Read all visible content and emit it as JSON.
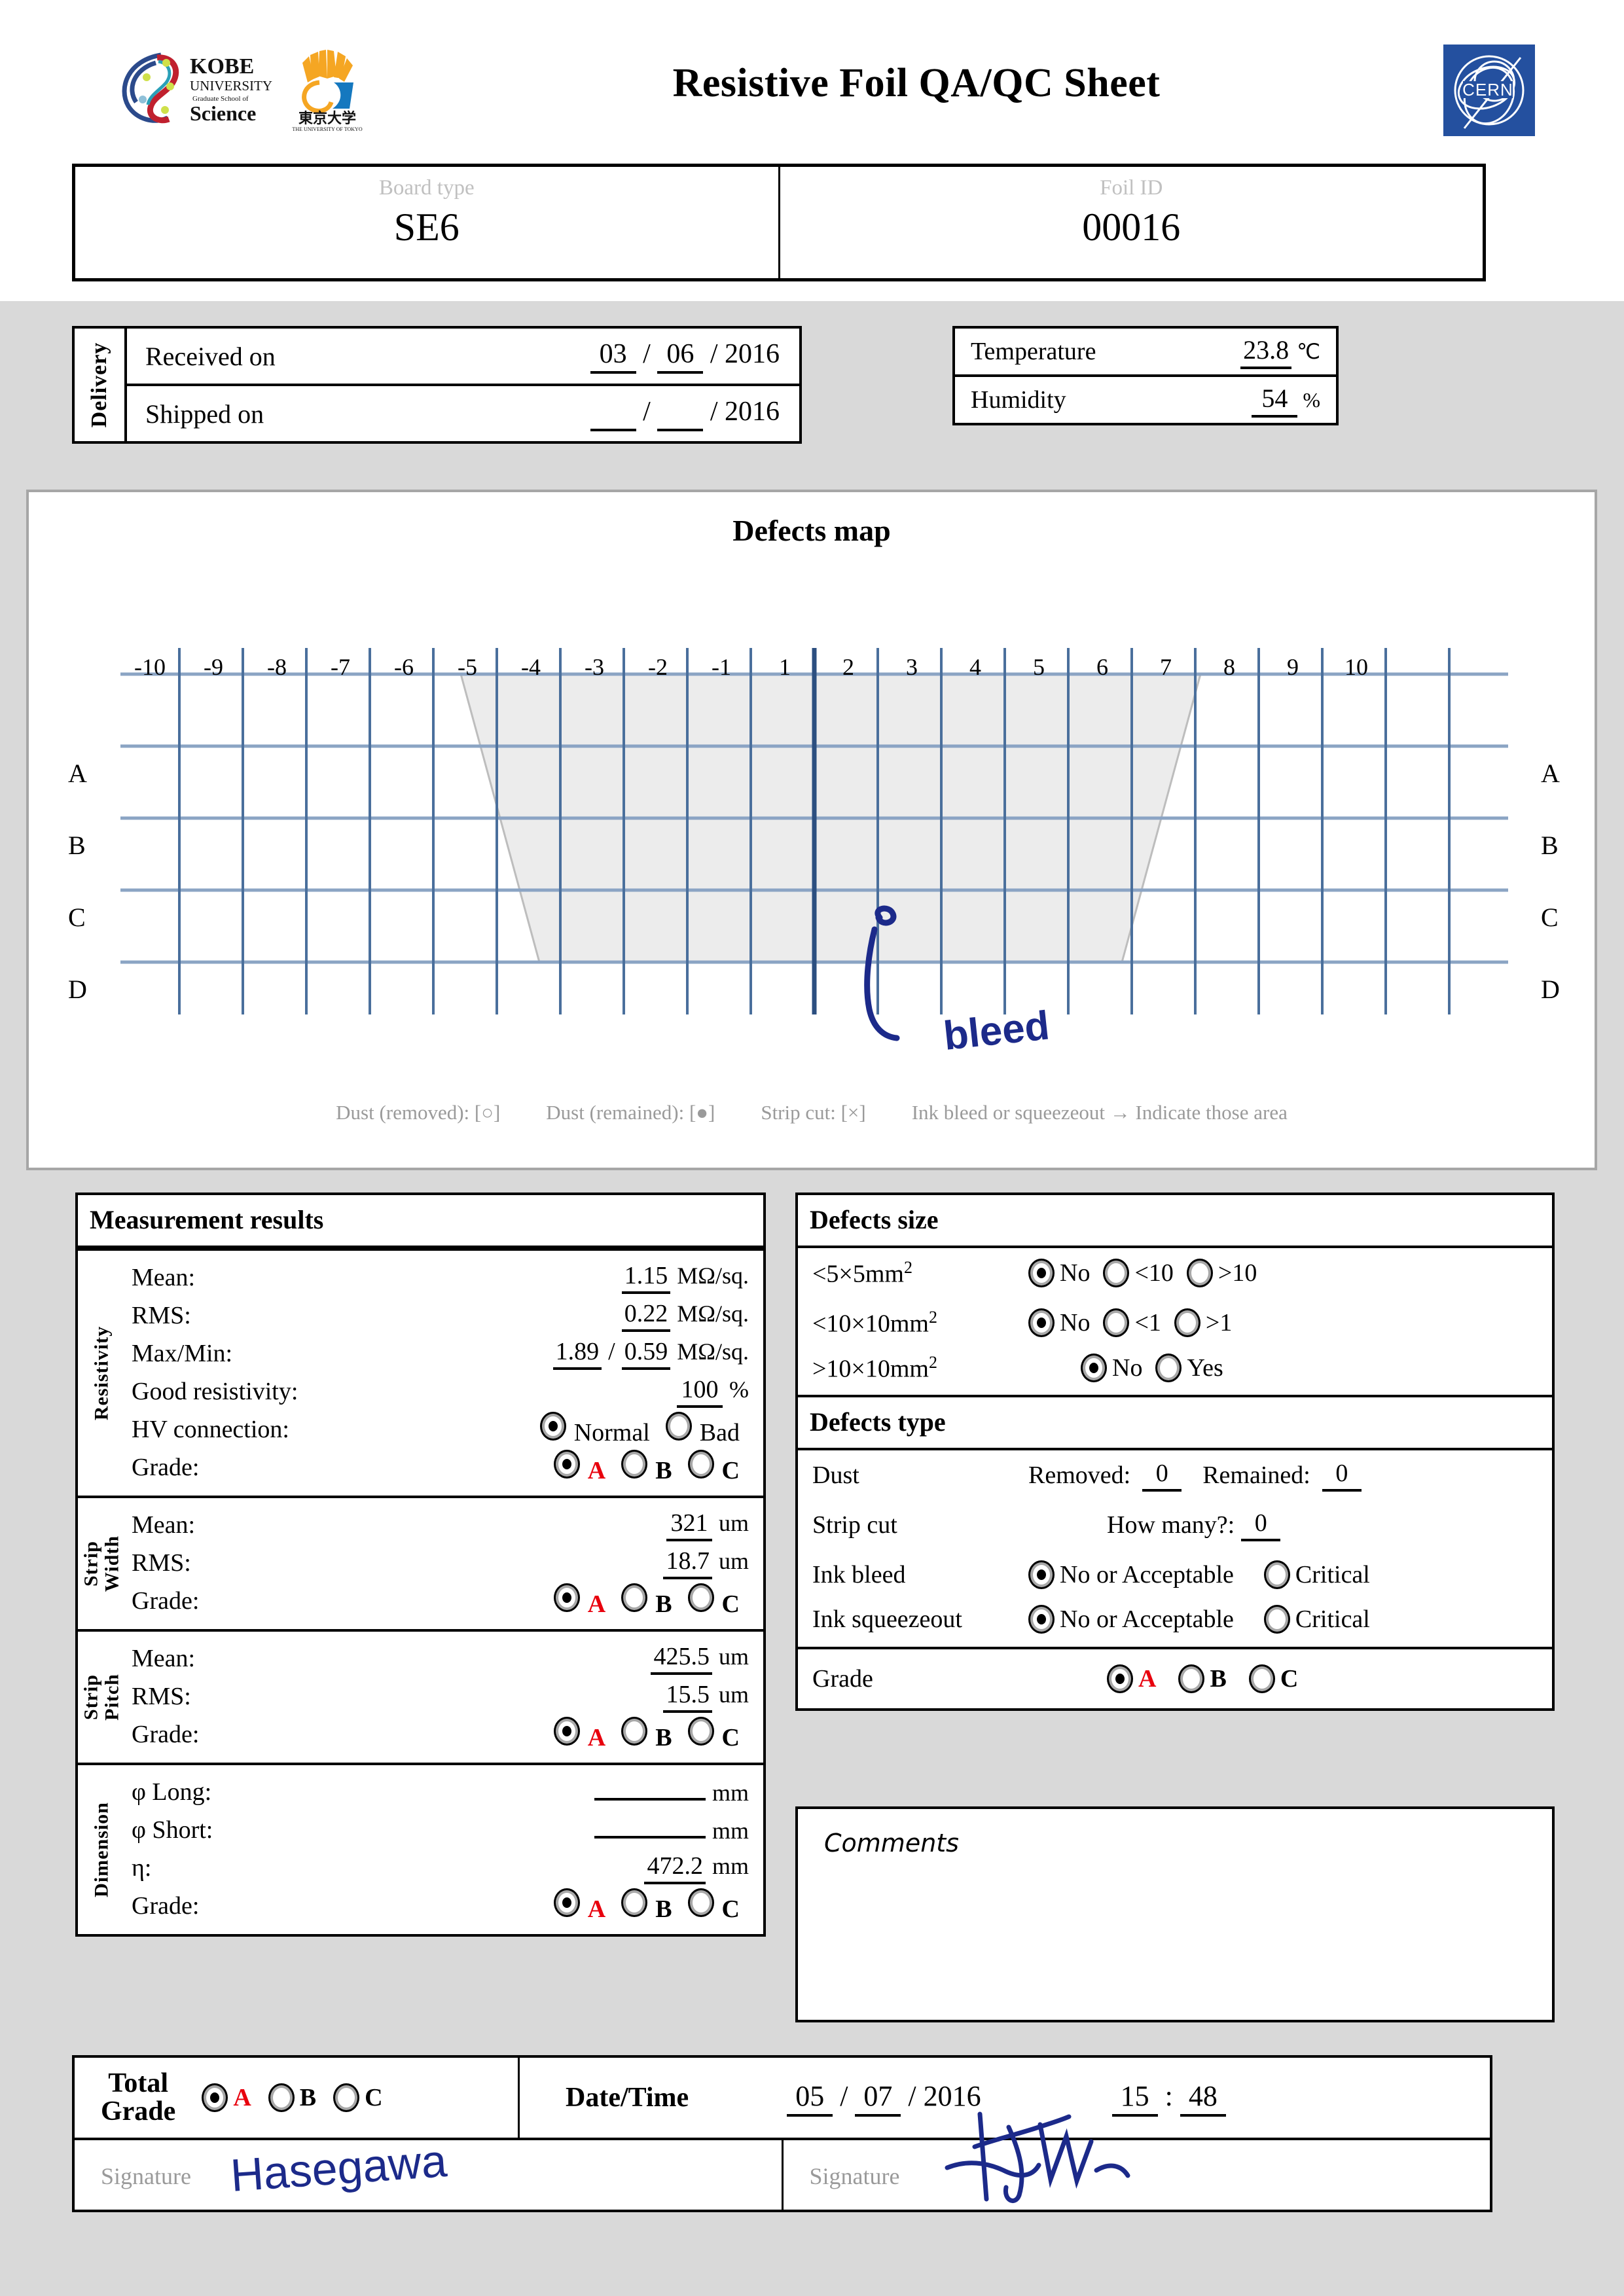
{
  "header": {
    "title": "Resistive Foil QA/QC Sheet",
    "logos": {
      "kobe_line1": "KOBE",
      "kobe_line2": "UNIVERSITY",
      "kobe_line3": "Graduate School of",
      "kobe_line4": "Science",
      "todai_jp": "東京大学",
      "todai_en": "THE UNIVERSITY OF TOKYO",
      "cern": "CERN"
    }
  },
  "identification": {
    "board_type_label": "Board type",
    "board_type_value": "SE6",
    "foil_id_label": "Foil ID",
    "foil_id_value": "00016"
  },
  "delivery": {
    "tab_label": "Delivery",
    "received_label": "Received on",
    "received_day": "03",
    "received_month": "06",
    "received_year": "2016",
    "shipped_label": "Shipped on",
    "shipped_day": "___",
    "shipped_month": "___",
    "shipped_year": "2016"
  },
  "environment": {
    "temperature_label": "Temperature",
    "temperature_value": "23.8",
    "temperature_unit": "℃",
    "humidity_label": "Humidity",
    "humidity_value": "54",
    "humidity_unit": "%"
  },
  "defects_map": {
    "title": "Defects map",
    "columns": [
      "-10",
      "-9",
      "-8",
      "-7",
      "-6",
      "-5",
      "-4",
      "-3",
      "-2",
      "-1",
      "1",
      "2",
      "3",
      "4",
      "5",
      "6",
      "7",
      "8",
      "9",
      "10"
    ],
    "rows": [
      "A",
      "B",
      "C",
      "D"
    ],
    "annotation_text": "bleed",
    "legend": [
      "Dust (removed): [○]",
      "Dust (remained): [●]",
      "Strip cut: [×]",
      "Ink bleed or squeezeout → Indicate those area"
    ]
  },
  "measurement": {
    "panel_title": "Measurement results",
    "resistivity": {
      "tab": "Resistivity",
      "mean_label": "Mean:",
      "mean_value": "1.15",
      "mean_unit": "MΩ/sq.",
      "rms_label": "RMS:",
      "rms_value": "0.22",
      "rms_unit": "MΩ/sq.",
      "maxmin_label": "Max/Min:",
      "max_value": "1.89",
      "min_value": "0.59",
      "maxmin_unit": "MΩ/sq.",
      "good_label": "Good resistivity:",
      "good_value": "100",
      "good_unit": "%",
      "hv_label": "HV connection:",
      "hv_options": [
        "Normal",
        "Bad"
      ],
      "hv_selected": "Normal",
      "grade_label": "Grade:",
      "grade_options": [
        "A",
        "B",
        "C"
      ],
      "grade_selected": "A"
    },
    "strip_width": {
      "tab_line1": "Strip",
      "tab_line2": "Width",
      "mean_label": "Mean:",
      "mean_value": "321",
      "mean_unit": "um",
      "rms_label": "RMS:",
      "rms_value": "18.7",
      "rms_unit": "um",
      "grade_label": "Grade:",
      "grade_options": [
        "A",
        "B",
        "C"
      ],
      "grade_selected": "A"
    },
    "strip_pitch": {
      "tab_line1": "Strip",
      "tab_line2": "Pitch",
      "mean_label": "Mean:",
      "mean_value": "425.5",
      "mean_unit": "um",
      "rms_label": "RMS:",
      "rms_value": "15.5",
      "rms_unit": "um",
      "grade_label": "Grade:",
      "grade_options": [
        "A",
        "B",
        "C"
      ],
      "grade_selected": "A"
    },
    "dimension": {
      "tab": "Dimension",
      "long_label": "φ Long:",
      "long_value": "",
      "long_unit": "mm",
      "short_label": "φ Short:",
      "short_value": "",
      "short_unit": "mm",
      "eta_label": "η:",
      "eta_value": "472.2",
      "eta_unit": "mm",
      "grade_label": "Grade:",
      "grade_options": [
        "A",
        "B",
        "C"
      ],
      "grade_selected": "A"
    }
  },
  "defects_size": {
    "panel_title": "Defects size",
    "rows": [
      {
        "label_pre": "<5×5mm",
        "label_sup": "2",
        "options": [
          "No",
          "<10",
          ">10"
        ],
        "selected": "No"
      },
      {
        "label_pre": "<10×10mm",
        "label_sup": "2",
        "options": [
          "No",
          "<1",
          ">1"
        ],
        "selected": "No"
      },
      {
        "label_pre": ">10×10mm",
        "label_sup": "2",
        "options": [
          "No",
          "Yes"
        ],
        "selected": "No"
      }
    ]
  },
  "defects_type": {
    "panel_title": "Defects type",
    "dust_label": "Dust",
    "dust_removed_label": "Removed:",
    "dust_removed_value": "0",
    "dust_remained_label": "Remained:",
    "dust_remained_value": "0",
    "strip_cut_label": "Strip cut",
    "strip_cut_q_label": "How many?:",
    "strip_cut_value": "0",
    "ink_bleed_label": "Ink bleed",
    "ink_bleed_options": [
      "No or Acceptable",
      "Critical"
    ],
    "ink_bleed_selected": "No or Acceptable",
    "ink_squeezeout_label": "Ink squeezeout",
    "ink_squeezeout_options": [
      "No or Acceptable",
      "Critical"
    ],
    "ink_squeezeout_selected": "No or Acceptable",
    "grade_label": "Grade",
    "grade_options": [
      "A",
      "B",
      "C"
    ],
    "grade_selected": "A"
  },
  "comments": {
    "label": "Comments",
    "value": ""
  },
  "footer": {
    "total_grade_line1": "Total",
    "total_grade_line2": "Grade",
    "total_grade_options": [
      "A",
      "B",
      "C"
    ],
    "total_grade_selected": "A",
    "datetime_label": "Date/Time",
    "date_day": "05",
    "date_month": "07",
    "date_year": "2016",
    "time_hour": "15",
    "time_min": "48",
    "signature_label_1": "Signature",
    "signature_value_1": "Hasegawa",
    "signature_label_2": "Signature",
    "signature_value_2": ""
  },
  "colors": {
    "grade_a_red": "#e8000d",
    "grid_blue": "#4a6f9c",
    "panel_grey": "#d9d9d9",
    "foil_grey": "#ececec",
    "ink_blue": "#1c2a8a",
    "cern_blue": "#24509f"
  }
}
